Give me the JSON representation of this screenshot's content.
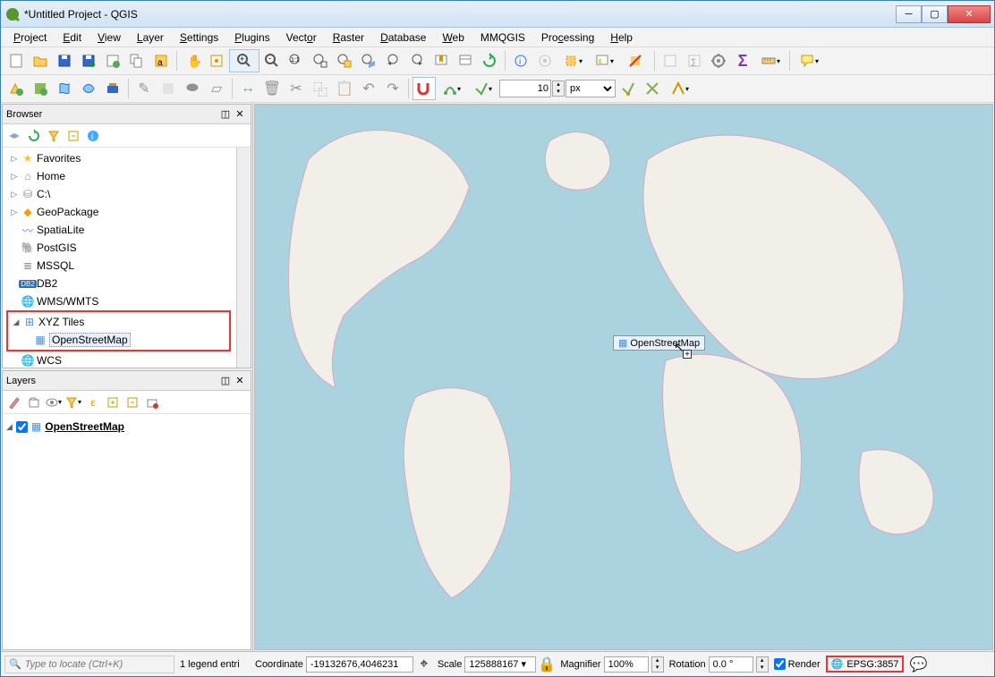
{
  "window": {
    "title": "*Untitled Project - QGIS"
  },
  "menu": {
    "project": "Project",
    "edit": "Edit",
    "view": "View",
    "layer": "Layer",
    "settings": "Settings",
    "plugins": "Plugins",
    "vector": "Vector",
    "raster": "Raster",
    "database": "Database",
    "web": "Web",
    "mmqgis": "MMQGIS",
    "processing": "Processing",
    "help": "Help"
  },
  "toolbar2": {
    "snap_value": "10",
    "snap_unit": "px"
  },
  "browser": {
    "title": "Browser",
    "items": {
      "favorites": "Favorites",
      "home": "Home",
      "cdrive": "C:\\",
      "geopackage": "GeoPackage",
      "spatialite": "SpatiaLite",
      "postgis": "PostGIS",
      "mssql": "MSSQL",
      "db2": "DB2",
      "wms": "WMS/WMTS",
      "xyz": "XYZ Tiles",
      "osm": "OpenStreetMap",
      "wcs": "WCS"
    }
  },
  "layers": {
    "title": "Layers",
    "items": {
      "osm": "OpenStreetMap"
    }
  },
  "drag": {
    "label": "OpenStreetMap"
  },
  "status": {
    "locate_placeholder": "Type to locate (Ctrl+K)",
    "legend": "1 legend entri",
    "coord_label": "Coordinate",
    "coord_value": "-19132676,4046231",
    "scale_label": "Scale",
    "scale_value": "125888167",
    "magnifier_label": "Magnifier",
    "magnifier_value": "100%",
    "rotation_label": "Rotation",
    "rotation_value": "0.0 °",
    "render_label": "Render",
    "crs": "EPSG:3857"
  }
}
